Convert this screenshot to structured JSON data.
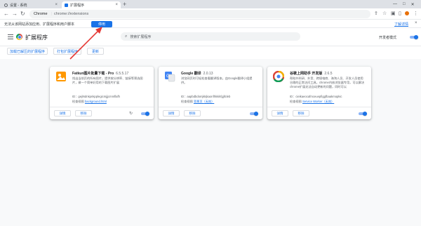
{
  "tabs": [
    {
      "title": "设置 - 系统",
      "active": false
    },
    {
      "title": "扩展程序",
      "active": true
    }
  ],
  "toolbar": {
    "scheme": "Chrome",
    "url": "chrome://extensions"
  },
  "infobar": {
    "message": "无法从该网站添加应用、扩展程序和用户脚本",
    "disable_label": "停用",
    "learn_more": "了解详情",
    "close_glyph": "×"
  },
  "header": {
    "title": "扩展程序",
    "search_placeholder": "搜索扩展程序",
    "devmode_label": "开发者模式"
  },
  "dev_buttons": {
    "load_unpacked": "加载已解压的扩展程序",
    "pack": "打包扩展程序",
    "update": "更新"
  },
  "cards": [
    {
      "name": "Fatkun图片批量下载 - Pro",
      "version": "6.5.5.17",
      "description": "找出当前页的所有图片，提供按分辨率、链接等筛选图片，做一个简单好用的下载图片扩展",
      "id_label": "ID：",
      "id": "gejiNdnkpnkpplegicmjjjcmmflafh",
      "view_label": "检查视图",
      "view_link": "background.html",
      "details_label": "详情",
      "remove_label": "移除",
      "enabled": true
    },
    {
      "name": "Google 翻译",
      "version": "2.0.13",
      "description": "浏览网页时可轻松查看翻译版本。由Google翻译小组提供。",
      "id_label": "ID：",
      "id": "aapbdbdomjkkjkaonfhkkikfgjllcleb",
      "view_label": "检查视图",
      "view_link": "背景页（无效）",
      "details_label": "详情",
      "remove_label": "移除",
      "enabled": true
    },
    {
      "name": "谷歌上网助手 开发版",
      "version": "2.6.5",
      "description": "帮助外科研、外贸、跨境电商、海淘人员、开发人员使用谷歌的正常访问工具，chrome内核浏览器专用，可以解决chrome扩展无法自动更新的问题，同时可以",
      "id_label": "ID：",
      "id": "cieikaeocafmceuepfiggfbaakmopkic",
      "view_label": "检查视图",
      "view_link": "Service Worker（无效）",
      "details_label": "详情",
      "remove_label": "移除",
      "enabled": true
    }
  ],
  "colors": {
    "accent": "#1a73e8",
    "arrow": "#e53935"
  }
}
